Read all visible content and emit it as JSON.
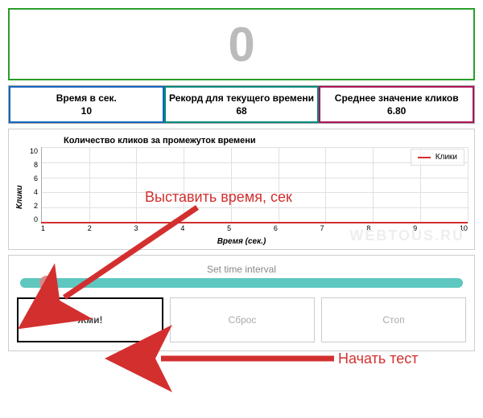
{
  "counter": {
    "value": "0"
  },
  "stats": {
    "time_label": "Время в сек.",
    "time_value": "10",
    "record_label": "Рекорд для текущего времени",
    "record_value": "68",
    "avg_label": "Среднее значение кликов",
    "avg_value": "6.80"
  },
  "chart_data": {
    "type": "line",
    "title": "Количество кликов за промежуток времени",
    "xlabel": "Время (сек.)",
    "ylabel": "Клики",
    "x": [
      1,
      2,
      3,
      4,
      5,
      6,
      7,
      8,
      9,
      10
    ],
    "series": [
      {
        "name": "Клики",
        "values": [
          0,
          0,
          0,
          0,
          0,
          0,
          0,
          0,
          0,
          0
        ],
        "color": "#d32f2f"
      }
    ],
    "xlim": [
      1,
      10
    ],
    "ylim": [
      0,
      10
    ],
    "yticks": [
      0,
      2,
      4,
      6,
      8,
      10
    ],
    "xticks": [
      1,
      2,
      3,
      4,
      5,
      6,
      7,
      8,
      9,
      10
    ],
    "legend_position": "top-right",
    "grid": true
  },
  "controls": {
    "slider_label": "Set time interval",
    "buttons": {
      "press": "Жми!",
      "reset": "Сброс",
      "stop": "Стоп"
    }
  },
  "annotations": {
    "set_time": "Выставить время, сек",
    "start_test": "Начать тест"
  },
  "watermark": "WEBTOUS.RU",
  "colors": {
    "counter_border": "#2a9d2a",
    "time_border": "#1565c0",
    "record_border": "#00897b",
    "avg_border": "#ad1457",
    "accent_red": "#d32f2f",
    "slider": "#5ec8c0",
    "thumb": "#d98a8a"
  }
}
